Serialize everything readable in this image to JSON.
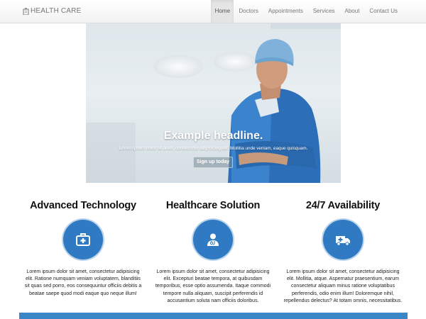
{
  "brand": {
    "name": "HEALTH CARE",
    "icon": "hospital-icon"
  },
  "nav": {
    "items": [
      {
        "label": "Home",
        "active": true
      },
      {
        "label": "Doctors"
      },
      {
        "label": "Appointments"
      },
      {
        "label": "Services"
      },
      {
        "label": "About"
      },
      {
        "label": "Contact Us"
      }
    ]
  },
  "hero": {
    "headline": "Example headline.",
    "subtext": "Lorem ipsum dolor sit amet, consectetur adipisicing elit. Mollitia unde veniam, eaque quisquam.",
    "button": "Sign up today"
  },
  "features": [
    {
      "title": "Advanced Technology",
      "icon": "medical-kit-icon",
      "text": "Lorem ipsum dolor sit amet, consectetur adipisicing elit. Ratione numquam veniam voluptatem, blanditiis sit quas sed porro, eos consequuntur officiis debitis a beatae saepe quod modi eaque quo neque illum!"
    },
    {
      "title": "Healthcare Solution",
      "icon": "doctor-icon",
      "text": "Lorem ipsum dolor sit amet, consectetur adipisicing elit. Excepturi beatae tempora, at quibusdam temporibus, esse optio assumenda. Itaque commodi tempore nulla aliquam, suscipit perferendis id accusantium soluta nam officiis doloribus."
    },
    {
      "title": "24/7 Availability",
      "icon": "ambulance-icon",
      "text": "Lorem ipsum dolor sit amet, consectetur adipisicing elit. Mollitia, atque. Aspernatur praesentium, earum consectetur aliquam minus ratione voluptatibus perferendis, odio enim illum! Doloremque nihil, repellendus delectus? At totam omnis, necessitatibus."
    }
  ],
  "colors": {
    "accent": "#2f7ac2",
    "footer_bar": "#3b86c7"
  }
}
